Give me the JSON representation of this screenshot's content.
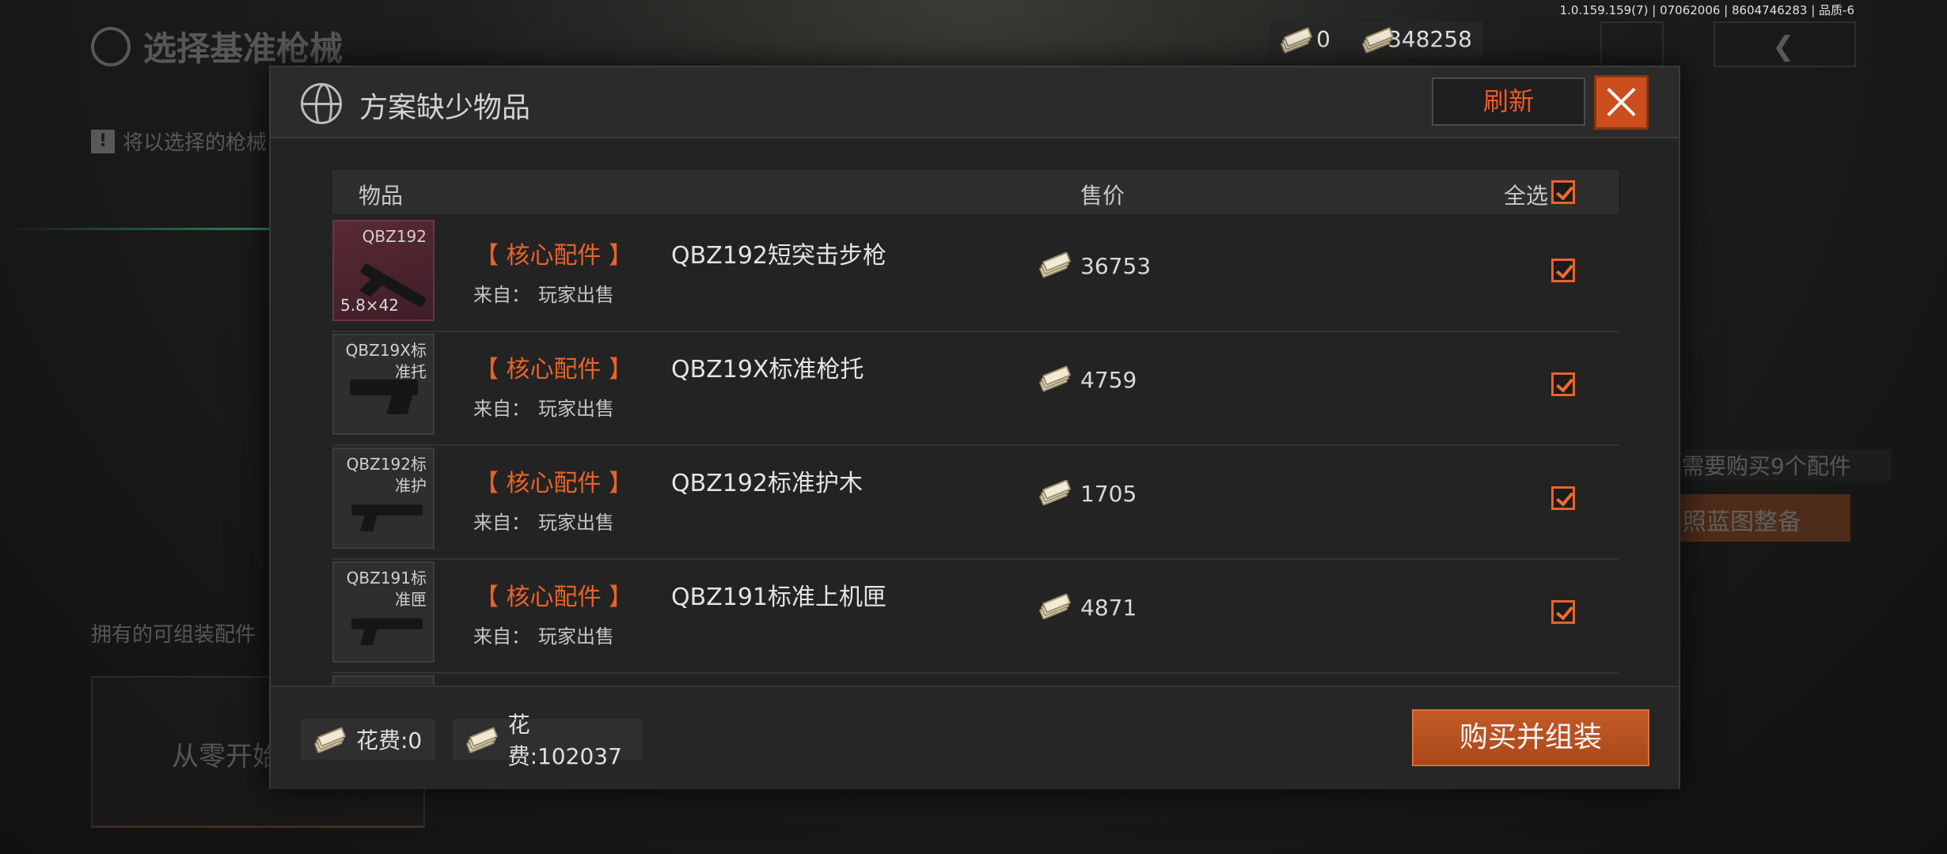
{
  "version": "1.0.159.159(7) | 07062006 | 8604746283 | 品质-6",
  "currency": {
    "a": "0",
    "b": "348258"
  },
  "background": {
    "title": "选择基准枪械",
    "hint": "将以选择的枪械",
    "owned": "拥有的可组装配件",
    "scratch": "从零开始",
    "need": "需要购买9个配件",
    "blueprint": "照蓝图整备"
  },
  "dialog": {
    "title": "方案缺少物品",
    "refresh": "刷新",
    "headers": {
      "item": "物品",
      "price": "售价",
      "select_all": "全选"
    },
    "rows": [
      {
        "thumb": "QBZ192",
        "caliber": "5.8×42",
        "tag": "【 核心配件 】",
        "name": "QBZ192短突击步枪",
        "from_label": "来自：",
        "from": "玩家出售",
        "price": "36753"
      },
      {
        "thumb": "QBZ19X标准托",
        "caliber": "",
        "tag": "【 核心配件 】",
        "name": "QBZ19X标准枪托",
        "from_label": "来自：",
        "from": "玩家出售",
        "price": "4759"
      },
      {
        "thumb": "QBZ192标准护",
        "caliber": "",
        "tag": "【 核心配件 】",
        "name": "QBZ192标准护木",
        "from_label": "来自：",
        "from": "玩家出售",
        "price": "1705"
      },
      {
        "thumb": "QBZ191标准匣",
        "caliber": "",
        "tag": "【 核心配件 】",
        "name": "QBZ191标准上机匣",
        "from_label": "来自：",
        "from": "玩家出售",
        "price": "4871"
      }
    ],
    "footer": {
      "cost_a": "花费:0",
      "cost_b": "花费:102037",
      "buy": "购买并组装"
    }
  },
  "colors": {
    "accent": "#e8632b",
    "close_bg": "#cc4e1e",
    "buy_bg": "#b3531f"
  },
  "icons": [
    "globe-icon",
    "cash-icon",
    "close-icon",
    "checkbox-checked-icon",
    "back-arrow-icon",
    "avatar-icon"
  ]
}
